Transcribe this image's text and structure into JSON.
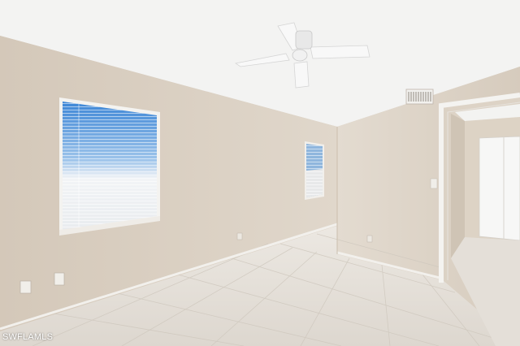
{
  "scene": {
    "description_free": true,
    "wall_color": "#d9cfc2",
    "ceiling_color": "#f4f4f3",
    "floor_color": "#e6e1da",
    "trim_color": "#f3f2ef",
    "door_color": "#f7f7f6"
  },
  "watermark": {
    "text": "SWFLAMLS"
  }
}
